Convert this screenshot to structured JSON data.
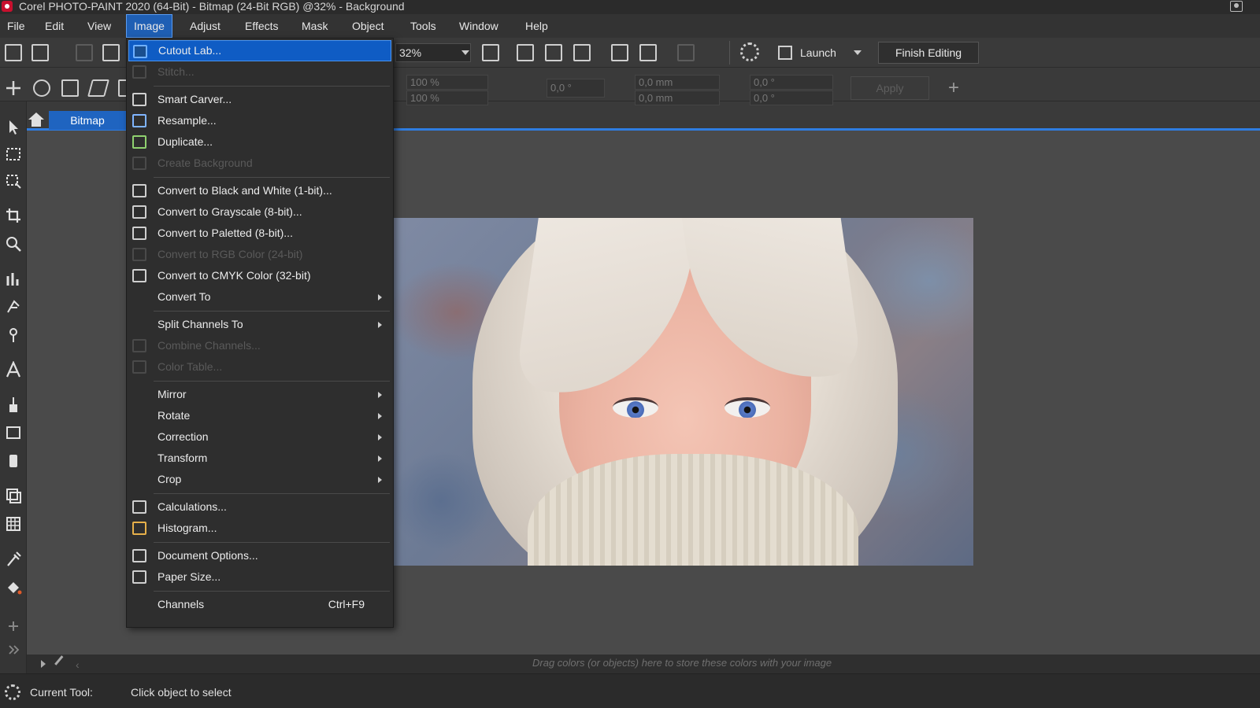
{
  "window": {
    "title": "Corel PHOTO-PAINT 2020 (64-Bit) - Bitmap (24-Bit RGB) @32% - Background"
  },
  "menubar": {
    "items": [
      {
        "label": "File"
      },
      {
        "label": "Edit"
      },
      {
        "label": "View"
      },
      {
        "label": "Image"
      },
      {
        "label": "Adjust"
      },
      {
        "label": "Effects"
      },
      {
        "label": "Mask"
      },
      {
        "label": "Object"
      },
      {
        "label": "Tools"
      },
      {
        "label": "Window"
      },
      {
        "label": "Help"
      }
    ],
    "active": "Image"
  },
  "toolbar": {
    "zoom_value": "32%",
    "launch_label": "Launch",
    "finish_label": "Finish Editing"
  },
  "property_bar": {
    "scale_x": "100 %",
    "scale_y": "100 %",
    "angle": "0,0 °",
    "pos_x": "0,0 mm",
    "pos_y": "0,0 mm",
    "skew_x": "0,0 °",
    "skew_y": "0,0 °",
    "apply_label": "Apply"
  },
  "tabs": {
    "document": "Bitmap"
  },
  "image_menu": {
    "items": [
      {
        "label": "Cutout Lab...",
        "icon": "cutout-lab-icon",
        "state": "highlight"
      },
      {
        "label": "Stitch...",
        "icon": "stitch-icon",
        "state": "disabled"
      },
      {
        "label": "Smart Carver...",
        "icon": "smart-carver-icon",
        "state": "normal"
      },
      {
        "label": "Resample...",
        "icon": "resample-icon",
        "state": "normal"
      },
      {
        "label": "Duplicate...",
        "icon": "duplicate-icon",
        "state": "normal"
      },
      {
        "label": "Create Background",
        "icon": "create-background-icon",
        "state": "disabled"
      },
      {
        "label": "Convert to Black and White (1-bit)...",
        "icon": "bw-icon",
        "state": "normal"
      },
      {
        "label": "Convert to Grayscale (8-bit)...",
        "icon": "grayscale-icon",
        "state": "normal"
      },
      {
        "label": "Convert to Paletted (8-bit)...",
        "icon": "paletted-icon",
        "state": "normal"
      },
      {
        "label": "Convert to RGB Color (24-bit)",
        "icon": "rgb-icon",
        "state": "disabled"
      },
      {
        "label": "Convert to CMYK Color (32-bit)",
        "icon": "cmyk-icon",
        "state": "normal"
      },
      {
        "label": "Convert To",
        "icon": "",
        "state": "submenu"
      },
      {
        "label": "Split Channels To",
        "icon": "",
        "state": "submenu"
      },
      {
        "label": "Combine Channels...",
        "icon": "combine-channels-icon",
        "state": "disabled"
      },
      {
        "label": "Color Table...",
        "icon": "color-table-icon",
        "state": "disabled"
      },
      {
        "label": "Mirror",
        "icon": "",
        "state": "submenu"
      },
      {
        "label": "Rotate",
        "icon": "",
        "state": "submenu"
      },
      {
        "label": "Correction",
        "icon": "",
        "state": "submenu"
      },
      {
        "label": "Transform",
        "icon": "",
        "state": "submenu"
      },
      {
        "label": "Crop",
        "icon": "",
        "state": "submenu"
      },
      {
        "label": "Calculations...",
        "icon": "calculations-icon",
        "state": "normal"
      },
      {
        "label": "Histogram...",
        "icon": "histogram-icon",
        "state": "normal"
      },
      {
        "label": "Document Options...",
        "icon": "document-options-icon",
        "state": "normal"
      },
      {
        "label": "Paper Size...",
        "icon": "paper-size-icon",
        "state": "normal"
      },
      {
        "label": "Channels",
        "icon": "",
        "state": "normal",
        "shortcut": "Ctrl+F9"
      }
    ]
  },
  "color_tray": {
    "hint": "Drag colors (or objects) here to store these colors with your image"
  },
  "status": {
    "label": "Current Tool:",
    "value": "Click object to select"
  },
  "colors": {
    "accent": "#1f5fb4",
    "menu_bg": "#2e2e2e",
    "canvas_bg": "#4a4a4a"
  }
}
